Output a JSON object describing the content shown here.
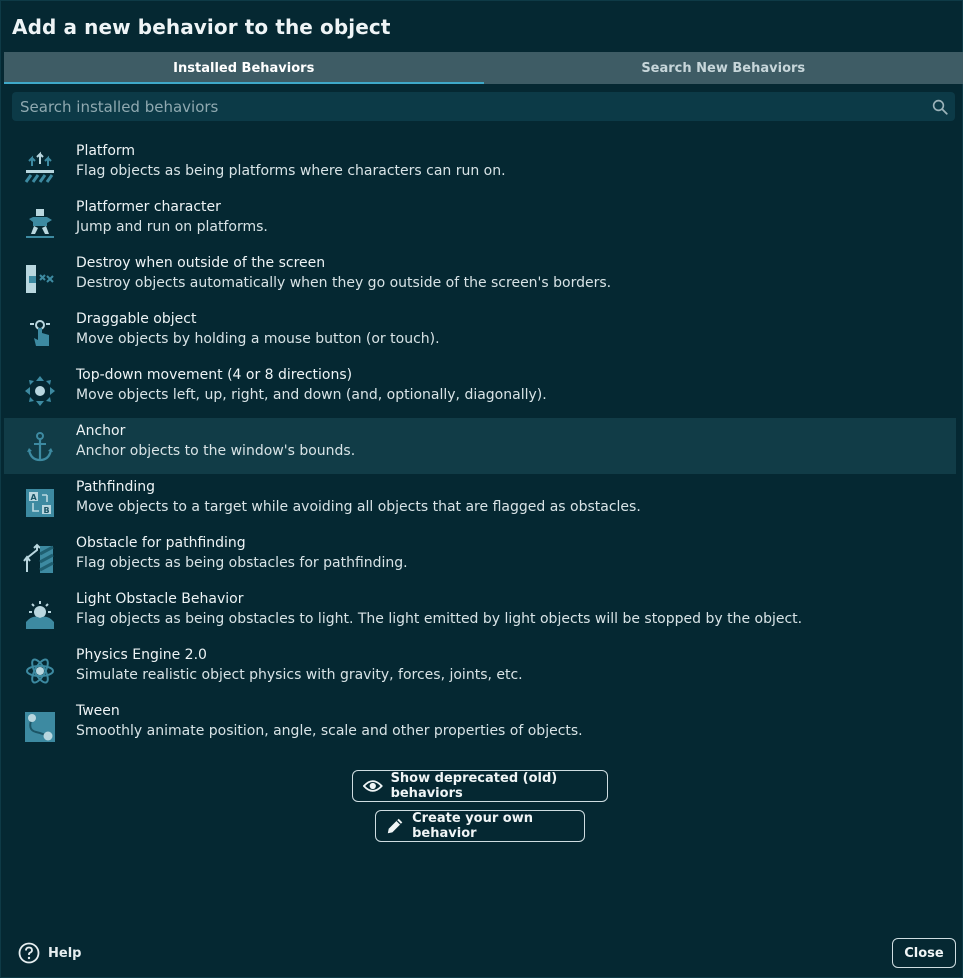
{
  "dialog": {
    "title": "Add a new behavior to the object"
  },
  "tabs": [
    {
      "label": "Installed Behaviors",
      "active": true
    },
    {
      "label": "Search New Behaviors",
      "active": false
    }
  ],
  "search": {
    "placeholder": "Search installed behaviors",
    "value": "",
    "icon": "search-icon"
  },
  "behaviors": [
    {
      "name": "Platform",
      "description": "Flag objects as being platforms where characters can run on.",
      "icon": "platform-icon"
    },
    {
      "name": "Platformer character",
      "description": "Jump and run on platforms.",
      "icon": "platformer-character-icon"
    },
    {
      "name": "Destroy when outside of the screen",
      "description": "Destroy objects automatically when they go outside of the screen's borders.",
      "icon": "destroy-outside-icon"
    },
    {
      "name": "Draggable object",
      "description": "Move objects by holding a mouse button (or touch).",
      "icon": "draggable-icon"
    },
    {
      "name": "Top-down movement (4 or 8 directions)",
      "description": "Move objects left, up, right, and down (and, optionally, diagonally).",
      "icon": "top-down-movement-icon"
    },
    {
      "name": "Anchor",
      "description": "Anchor objects to the window's bounds.",
      "icon": "anchor-icon",
      "selected": true
    },
    {
      "name": "Pathfinding",
      "description": "Move objects to a target while avoiding all objects that are flagged as obstacles.",
      "icon": "pathfinding-icon"
    },
    {
      "name": "Obstacle for pathfinding",
      "description": "Flag objects as being obstacles for pathfinding.",
      "icon": "obstacle-pathfinding-icon"
    },
    {
      "name": "Light Obstacle Behavior",
      "description": "Flag objects as being obstacles to light. The light emitted by light objects will be stopped by the object.",
      "icon": "light-obstacle-icon"
    },
    {
      "name": "Physics Engine 2.0",
      "description": "Simulate realistic object physics with gravity, forces, joints, etc.",
      "icon": "physics-engine-icon"
    },
    {
      "name": "Tween",
      "description": "Smoothly animate position, angle, scale and other properties of objects.",
      "icon": "tween-icon"
    }
  ],
  "actions": {
    "show_deprecated": "Show deprecated (old) behaviors",
    "create_own": "Create your own behavior"
  },
  "footer": {
    "help": "Help",
    "close": "Close"
  },
  "colors": {
    "background": "#052832",
    "tab_bar": "#3e5c65",
    "accent": "#3fa9c9",
    "selected_row": "#113c47",
    "icon_primary": "#3d8aa1",
    "icon_secondary": "#b9d7df"
  }
}
